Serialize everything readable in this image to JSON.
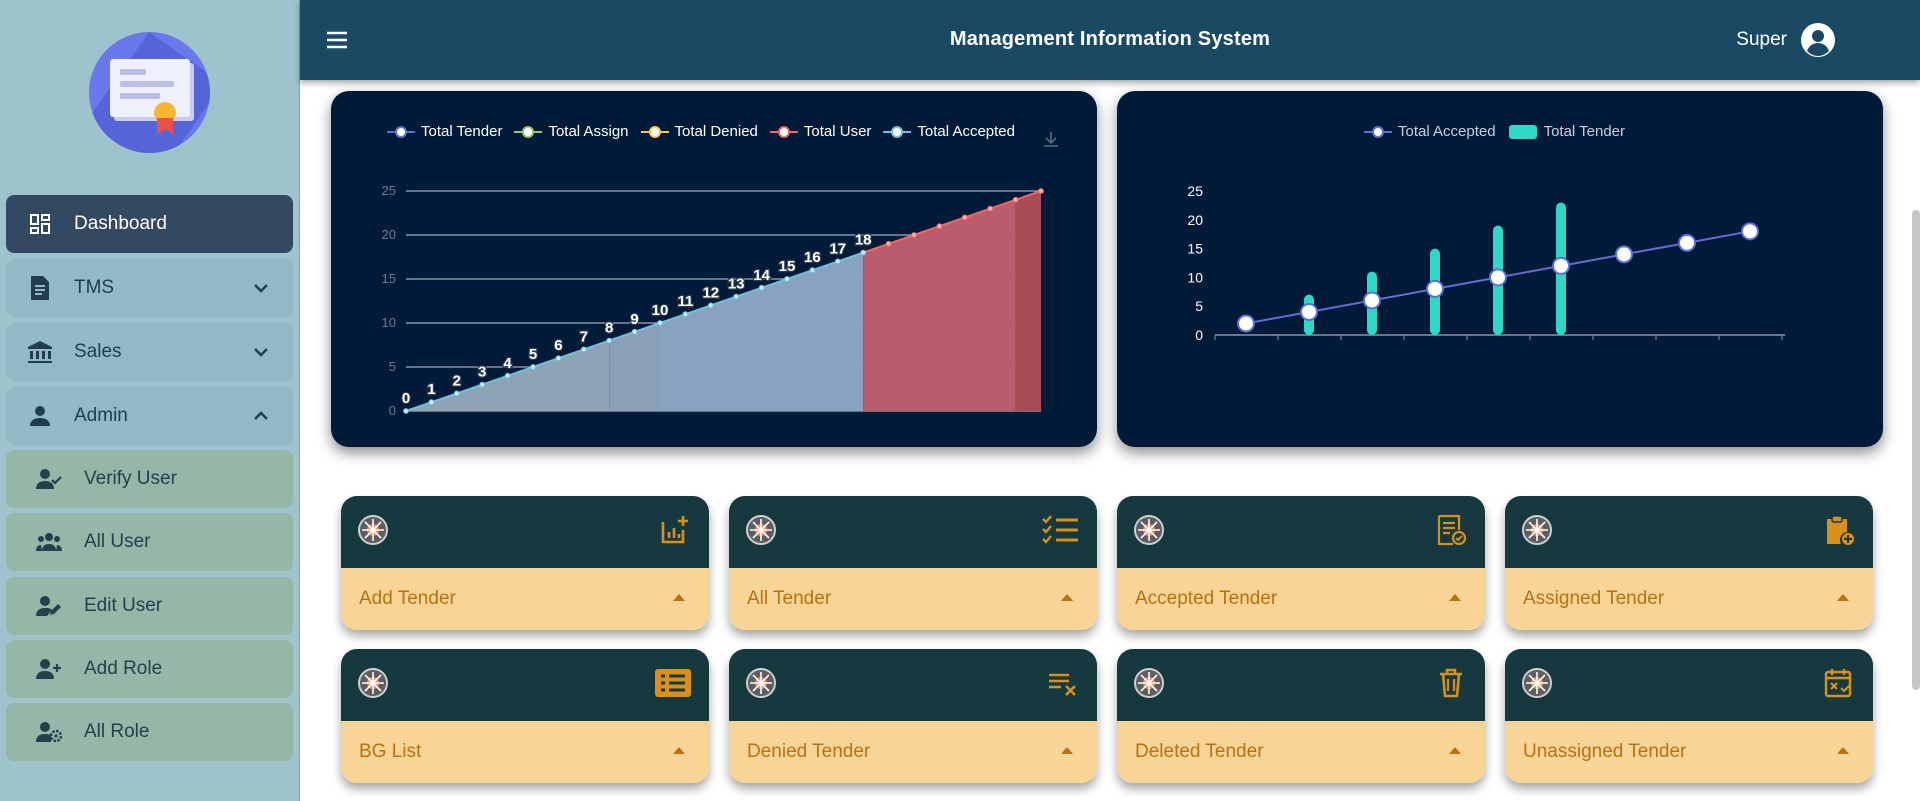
{
  "header": {
    "title": "Management Information System",
    "user": "Super"
  },
  "sidebar": {
    "items": [
      {
        "label": "Dashboard",
        "icon": "dashboard-icon",
        "active": true
      },
      {
        "label": "TMS",
        "icon": "document-icon",
        "expand": "chevron-down-icon"
      },
      {
        "label": "Sales",
        "icon": "bank-icon",
        "expand": "chevron-down-icon"
      },
      {
        "label": "Admin",
        "icon": "person-icon",
        "expand": "chevron-up-icon"
      }
    ],
    "admin_children": [
      {
        "label": "Verify User",
        "icon": "user-check-icon"
      },
      {
        "label": "All User",
        "icon": "users-icon"
      },
      {
        "label": "Edit User",
        "icon": "user-edit-icon"
      },
      {
        "label": "Add Role",
        "icon": "user-add-icon"
      },
      {
        "label": "All Role",
        "icon": "user-gear-icon"
      }
    ]
  },
  "chart_data": [
    {
      "type": "area",
      "legend": [
        "Total Tender",
        "Total Assign",
        "Total Denied",
        "Total User",
        "Total Accepted"
      ],
      "legend_colors": [
        "#5b6fd6",
        "#91cc75",
        "#fac858",
        "#ee6666",
        "#73c0de"
      ],
      "x": [
        0,
        1,
        2,
        3,
        4,
        5,
        6,
        7,
        8,
        9,
        10,
        11,
        12,
        13,
        14,
        15,
        16,
        17,
        18,
        19,
        20,
        21,
        22,
        23,
        24,
        25
      ],
      "values": [
        0,
        1,
        2,
        3,
        4,
        5,
        6,
        7,
        8,
        9,
        10,
        11,
        12,
        13,
        14,
        15,
        16,
        17,
        18,
        19,
        20,
        21,
        22,
        23,
        24,
        25
      ],
      "data_labels": [
        0,
        1,
        2,
        3,
        4,
        5,
        6,
        7,
        8,
        9,
        10,
        11,
        12,
        13,
        14,
        15,
        16,
        17,
        18
      ],
      "ylim": [
        0,
        25
      ],
      "yticks": [
        0,
        5,
        10,
        15,
        20,
        25
      ],
      "grid": true,
      "legend_position": "top"
    },
    {
      "type": "bar",
      "legend": [
        "Total Accepted",
        "Total Tender"
      ],
      "legend_colors": [
        "#5b6fd6",
        "#2ed8c7"
      ],
      "series": [
        {
          "name": "Total Accepted",
          "type": "line",
          "values": [
            2,
            4,
            6,
            8,
            10,
            12,
            14,
            16,
            18
          ]
        },
        {
          "name": "Total Tender",
          "type": "bar",
          "values": [
            0,
            7,
            11,
            15,
            19,
            23,
            0,
            0,
            0
          ]
        }
      ],
      "ylim": [
        0,
        25
      ],
      "yticks": [
        0,
        5,
        10,
        15,
        20,
        25
      ],
      "legend_position": "top"
    }
  ],
  "cards": [
    {
      "label": "Add Tender",
      "icon": "add-chart-icon"
    },
    {
      "label": "All Tender",
      "icon": "checklist-icon"
    },
    {
      "label": "Accepted Tender",
      "icon": "approved-doc-icon"
    },
    {
      "label": "Assigned Tender",
      "icon": "clipboard-add-icon"
    },
    {
      "label": "BG List",
      "icon": "list-icon"
    },
    {
      "label": "Denied Tender",
      "icon": "playlist-remove-icon"
    },
    {
      "label": "Deleted Tender",
      "icon": "trash-icon"
    },
    {
      "label": "Unassigned Tender",
      "icon": "calendar-remove-icon"
    }
  ],
  "colors": {
    "topbar": "#1a4a63",
    "sidebar": "#9ec3cc",
    "panel": "#011a37",
    "card_top": "#16383f",
    "card_bottom": "#f9d497",
    "accent": "#b8720f"
  }
}
